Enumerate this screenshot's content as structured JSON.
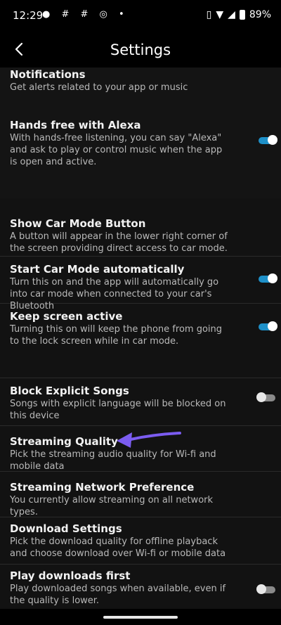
{
  "status": {
    "time": "12:29",
    "battery": "89%"
  },
  "header": {
    "title": "Settings"
  },
  "items": [
    {
      "title": "Notifications",
      "desc": "Get alerts related to your app or music"
    },
    {
      "title": "Hands free with Alexa",
      "desc": "With hands-free listening, you can say \"Alexa\" and ask to play or control music when the app is open and active.",
      "toggle": "on"
    },
    {
      "title": "Show Car Mode Button",
      "desc": "A button will appear in the lower right corner of the screen providing direct access to car mode."
    },
    {
      "title": "Start Car Mode automatically",
      "desc": "Turn this on and the app will automatically go into car mode when connected to your car's Bluetooth",
      "toggle": "on"
    },
    {
      "title": "Keep screen active",
      "desc": "Turning this on will keep the phone from going to the lock screen while in car mode.",
      "toggle": "on"
    },
    {
      "title": "Block Explicit Songs",
      "desc": "Songs with explicit language will be blocked on this device",
      "toggle": "off"
    },
    {
      "title": "Streaming Quality",
      "desc": "Pick the streaming audio quality for Wi-fi and mobile data"
    },
    {
      "title": "Streaming Network Preference",
      "desc": "You currently allow streaming on all network types."
    },
    {
      "title": "Download Settings",
      "desc": "Pick the download quality for offline playback and choose download over Wi-fi or mobile data"
    },
    {
      "title": "Play downloads first",
      "desc": "Play downloaded songs when available, even if the quality is lower.",
      "toggle": "off"
    }
  ],
  "colors": {
    "accent": "#1e90c8",
    "annotation_arrow": "#7b5cf0"
  }
}
